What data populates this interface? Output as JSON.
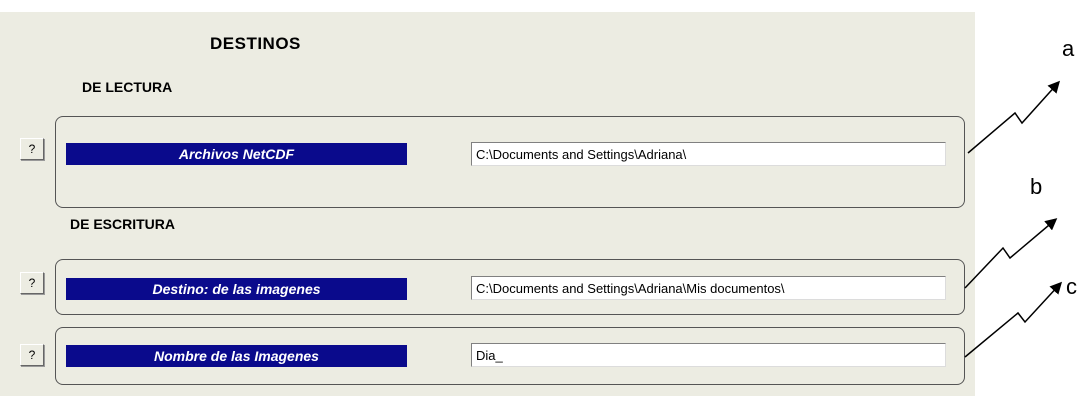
{
  "dialog": {
    "title": "DESTINOS",
    "read_section": "DE LECTURA",
    "write_section": "DE ESCRITURA"
  },
  "rows": [
    {
      "help_label": "?",
      "label": "Archivos NetCDF",
      "value": "C:\\Documents and Settings\\Adriana\\"
    },
    {
      "help_label": "?",
      "label": "Destino:  de  las imagenes",
      "value": "C:\\Documents and Settings\\Adriana\\Mis documentos\\"
    },
    {
      "help_label": "?",
      "label": "Nombre de las Imagenes",
      "value": "Dia_"
    }
  ],
  "callouts": [
    "a",
    "b",
    "c"
  ],
  "colors": {
    "panel_background": "#ecece2",
    "label_bar": "#0a0a8c",
    "label_text": "#ffffff"
  }
}
